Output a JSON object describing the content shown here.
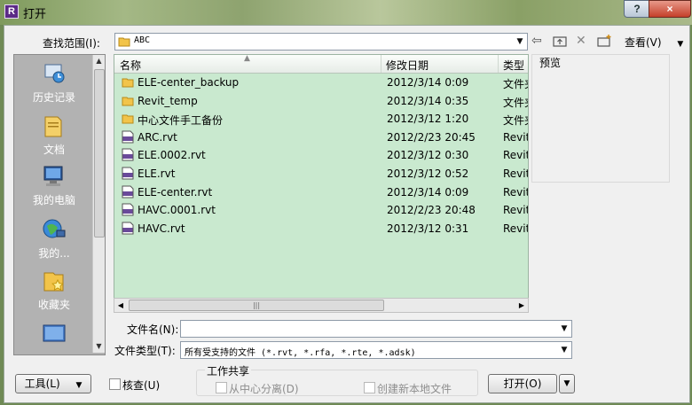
{
  "window": {
    "title": "打开",
    "app_icon": "R",
    "help": "?",
    "close": "×"
  },
  "toolbar": {
    "lookin_label": "查找范围(I):",
    "lookin_value": "ABC",
    "view_label": "查看(V)",
    "icons": [
      "back-arrow-icon",
      "up-folder-icon",
      "delete-icon",
      "new-folder-icon"
    ]
  },
  "places": [
    {
      "label": "历史记录",
      "icon": "history-icon"
    },
    {
      "label": "文档",
      "icon": "documents-icon"
    },
    {
      "label": "我的电脑",
      "icon": "computer-icon"
    },
    {
      "label": "我的...",
      "icon": "network-icon"
    },
    {
      "label": "收藏夹",
      "icon": "favorites-icon"
    },
    {
      "label": "",
      "icon": "desktop-icon"
    }
  ],
  "filelist": {
    "columns": [
      "名称",
      "修改日期",
      "类型"
    ],
    "rows": [
      {
        "name": "ELE-center_backup",
        "date": "2012/3/14 0:09",
        "type": "文件夹",
        "icon": "folder-icon"
      },
      {
        "name": "Revit_temp",
        "date": "2012/3/14 0:35",
        "type": "文件夹",
        "icon": "folder-icon"
      },
      {
        "name": "中心文件手工备份",
        "date": "2012/3/12 1:20",
        "type": "文件夹",
        "icon": "folder-icon"
      },
      {
        "name": "ARC.rvt",
        "date": "2012/2/23 20:45",
        "type": "Revit",
        "icon": "rvt-file-icon"
      },
      {
        "name": "ELE.0002.rvt",
        "date": "2012/3/12 0:30",
        "type": "Revit",
        "icon": "rvt-file-icon"
      },
      {
        "name": "ELE.rvt",
        "date": "2012/3/12 0:52",
        "type": "Revit",
        "icon": "rvt-file-icon"
      },
      {
        "name": "ELE-center.rvt",
        "date": "2012/3/14 0:09",
        "type": "Revit",
        "icon": "rvt-file-icon"
      },
      {
        "name": "HAVC.0001.rvt",
        "date": "2012/2/23 20:48",
        "type": "Revit",
        "icon": "rvt-file-icon"
      },
      {
        "name": "HAVC.rvt",
        "date": "2012/3/12 0:31",
        "type": "Revit",
        "icon": "rvt-file-icon"
      }
    ]
  },
  "preview": {
    "label": "预览"
  },
  "filename": {
    "label": "文件名(N):",
    "value": ""
  },
  "filetype": {
    "label": "文件类型(T):",
    "value": "所有受支持的文件 (*.rvt, *.rfa, *.rte, *.adsk)"
  },
  "bottom": {
    "tools_label": "工具(L)",
    "audit_label": "核查(U)",
    "worksharing_title": "工作共享",
    "detach_label": "从中心分离(D)",
    "create_local_label": "创建新本地文件",
    "open_label": "打开(O)"
  },
  "colors": {
    "list_bg": "#c9e9cf",
    "places_bg": "#b2b2b2"
  }
}
